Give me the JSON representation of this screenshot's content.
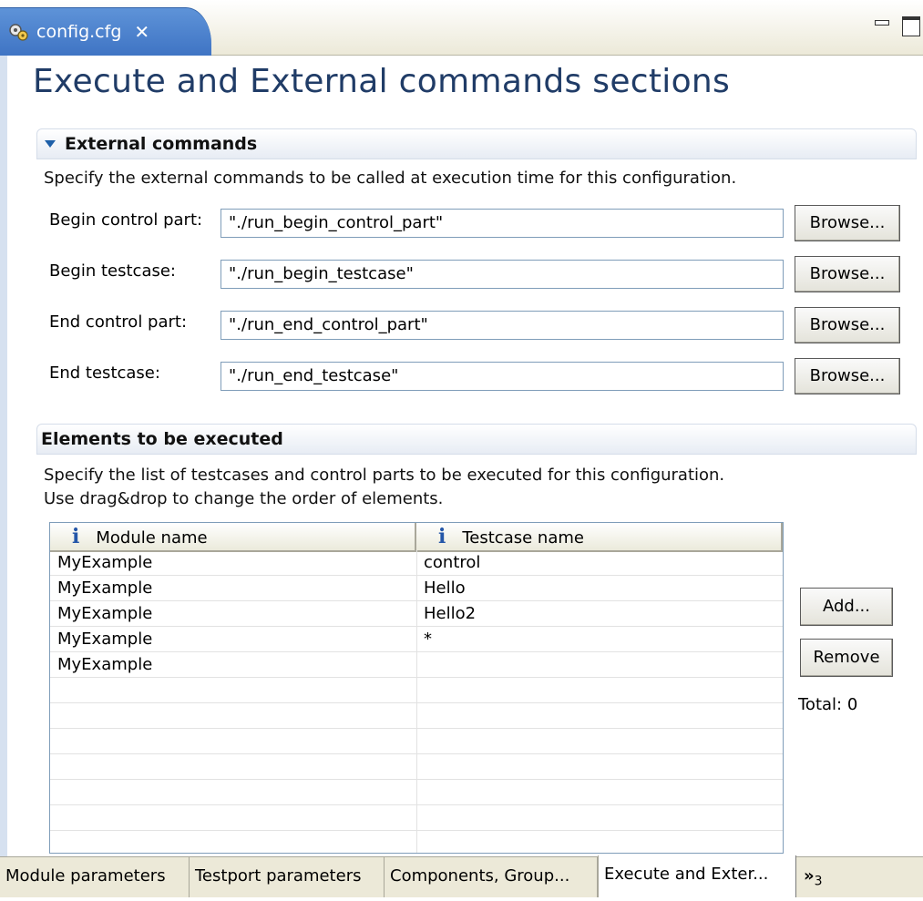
{
  "editor_tab": {
    "title": "config.cfg",
    "close": "✕"
  },
  "page_title": "Execute and External commands sections",
  "external_commands": {
    "header": "External commands",
    "description": "Specify the external commands to be called at execution time for this configuration.",
    "rows": [
      {
        "label": "Begin control part:",
        "value": "\"./run_begin_control_part\"",
        "button": "Browse..."
      },
      {
        "label": "Begin testcase:",
        "value": "\"./run_begin_testcase\"",
        "button": "Browse..."
      },
      {
        "label": "End control part:",
        "value": "\"./run_end_control_part\"",
        "button": "Browse..."
      },
      {
        "label": "End testcase:",
        "value": "\"./run_end_testcase\"",
        "button": "Browse..."
      }
    ]
  },
  "elements": {
    "header": "Elements to be executed",
    "description1": "Specify the list of testcases and control parts to be executed for this configuration.",
    "description2": "Use drag&drop to change the order of elements.",
    "columns": [
      "Module name",
      "Testcase name"
    ],
    "info_icon": "i",
    "rows": [
      [
        "MyExample",
        "control"
      ],
      [
        "MyExample",
        "Hello"
      ],
      [
        "MyExample",
        "Hello2"
      ],
      [
        "MyExample",
        "*"
      ],
      [
        "MyExample",
        ""
      ]
    ],
    "add_button": "Add...",
    "remove_button": "Remove",
    "total": "Total: 0"
  },
  "bottom_tabs": [
    "Module parameters",
    "Testport parameters",
    "Components, Group...",
    "Execute and Exter..."
  ],
  "more_tabs": {
    "chevron": "»",
    "count": "3"
  }
}
